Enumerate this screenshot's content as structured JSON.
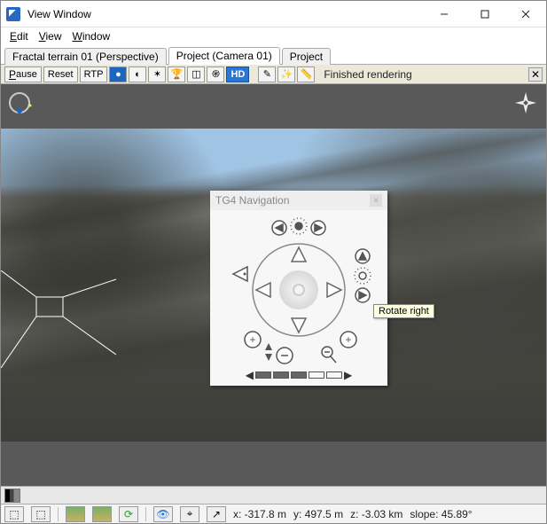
{
  "title": "View Window",
  "menu": {
    "edit": "Edit",
    "view": "View",
    "window": "Window"
  },
  "tabs": [
    {
      "label": "Fractal terrain 01 (Perspective)",
      "active": false
    },
    {
      "label": "Project (Camera 01)",
      "active": true
    },
    {
      "label": "Project",
      "active": false
    }
  ],
  "toolbar": {
    "pause": "Pause",
    "reset": "Reset",
    "rtp": "RTP",
    "hd": "HD",
    "status": "Finished rendering"
  },
  "nav_widget": {
    "title": "TG4 Navigation",
    "tooltip": "Rotate right"
  },
  "status": {
    "x": "x: -317.8 m",
    "y": "y: 497.5 m",
    "z": "z: -3.03 km",
    "slope": "slope: 45.89°"
  }
}
